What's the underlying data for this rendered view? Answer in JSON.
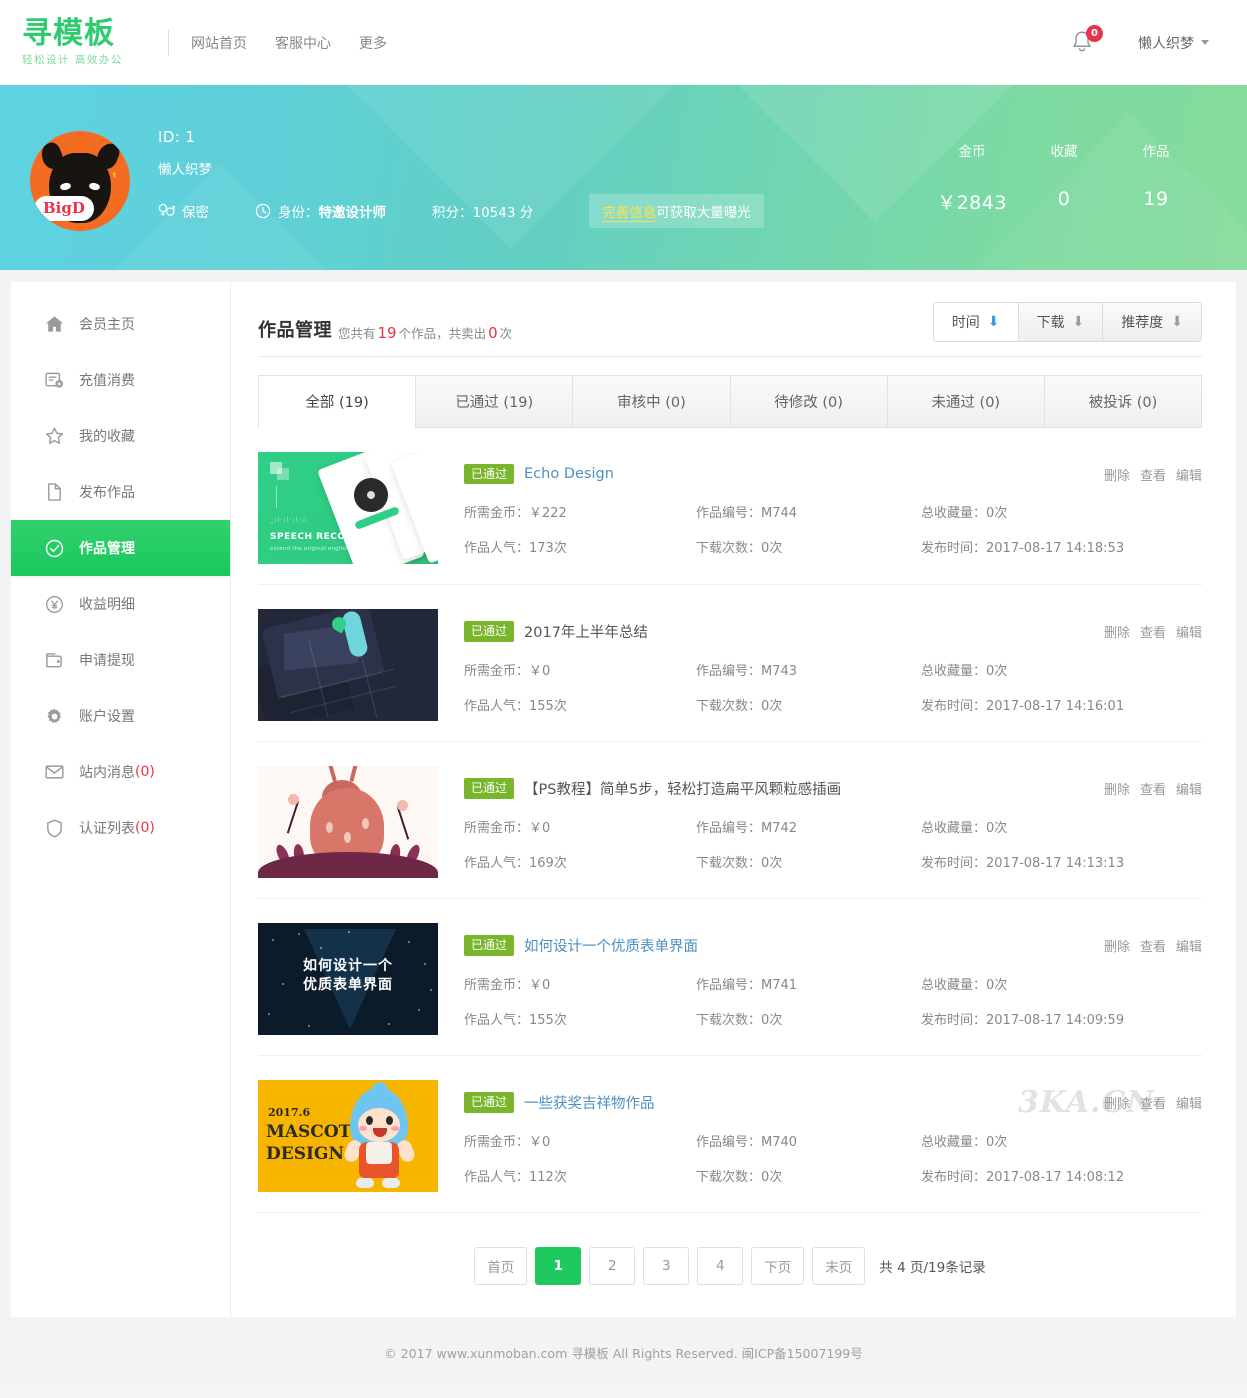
{
  "header": {
    "logo_main": "寻模板",
    "logo_sub": "轻松设计 高效办公",
    "nav": [
      {
        "label": "网站首页"
      },
      {
        "label": "客服中心"
      },
      {
        "label": "更多"
      }
    ],
    "notification_count": "0",
    "username": "懒人织梦"
  },
  "profile": {
    "avatar_text": "BigD",
    "id_label": "ID: 1",
    "nickname": "懒人织梦",
    "gender": "保密",
    "identity_label": "身份：",
    "identity_value": "特邀设计师",
    "points": "积分：10543 分",
    "promo_link": "完善信息",
    "promo_rest": "可获取大量曝光",
    "stats": [
      {
        "label": "金币",
        "value": "￥2843"
      },
      {
        "label": "收藏",
        "value": "0"
      },
      {
        "label": "作品",
        "value": "19"
      }
    ]
  },
  "sidebar": {
    "items": [
      {
        "label": "会员主页",
        "icon": "home-icon",
        "active": false
      },
      {
        "label": "充值消费",
        "icon": "card-icon",
        "active": false
      },
      {
        "label": "我的收藏",
        "icon": "star-icon",
        "active": false
      },
      {
        "label": "发布作品",
        "icon": "file-icon",
        "active": false
      },
      {
        "label": "作品管理",
        "icon": "check-circle-icon",
        "active": true
      },
      {
        "label": "收益明细",
        "icon": "yen-circle-icon",
        "active": false
      },
      {
        "label": "申请提现",
        "icon": "wallet-icon",
        "active": false
      },
      {
        "label": "账户设置",
        "icon": "gear-icon",
        "active": false
      },
      {
        "label": "站内消息",
        "count": "(0)",
        "icon": "envelope-icon",
        "active": false
      },
      {
        "label": "认证列表",
        "count": "(0)",
        "icon": "shield-icon",
        "active": false
      }
    ]
  },
  "main": {
    "title": "作品管理",
    "sub_pre": "您共有",
    "sub_count": "19",
    "sub_mid": "个作品，共卖出",
    "sub_sold": "0",
    "sub_end": "次",
    "sorts": [
      {
        "label": "时间",
        "active": true
      },
      {
        "label": "下载",
        "active": false
      },
      {
        "label": "推荐度",
        "active": false
      }
    ],
    "tabs": [
      {
        "label": "全部 (19)",
        "active": true
      },
      {
        "label": "已通过 (19)",
        "active": false
      },
      {
        "label": "审核中 (0)",
        "active": false
      },
      {
        "label": "待修改 (0)",
        "active": false
      },
      {
        "label": "未通过 (0)",
        "active": false
      },
      {
        "label": "被投诉 (0)",
        "active": false
      }
    ],
    "actions": [
      "删除",
      "查看",
      "编辑"
    ],
    "field_labels": {
      "coin": "所需金币：",
      "code": "作品编号：",
      "favs": "总收藏量：",
      "views": "作品人气：",
      "downloads": "下载次数：",
      "time": "发布时间："
    },
    "watermark": "3KA.CN",
    "works": [
      {
        "status": "已通过",
        "title": "Echo Design",
        "title_link": true,
        "coin": "￥222",
        "code": "M744",
        "favs": "0次",
        "views": "173次",
        "downloads": "0次",
        "time": "2017-08-17 14:18:53",
        "thumb_caption": "SPEECH RECOGNITION",
        "thumb_sub": "extend the original english wordless chat"
      },
      {
        "status": "已通过",
        "title": "2017年上半年总结",
        "title_link": false,
        "coin": "￥0",
        "code": "M743",
        "favs": "0次",
        "views": "155次",
        "downloads": "0次",
        "time": "2017-08-17 14:16:01"
      },
      {
        "status": "已通过",
        "title": "【PS教程】简单5步，轻松打造扁平风颗粒感插画",
        "title_link": false,
        "coin": "￥0",
        "code": "M742",
        "favs": "0次",
        "views": "169次",
        "downloads": "0次",
        "time": "2017-08-17 14:13:13"
      },
      {
        "status": "已通过",
        "title": "如何设计一个优质表单界面",
        "title_link": true,
        "coin": "￥0",
        "code": "M741",
        "favs": "0次",
        "views": "155次",
        "downloads": "0次",
        "time": "2017-08-17 14:09:59",
        "thumb_caption": "如何设计一个\n优质表单界面"
      },
      {
        "status": "已通过",
        "title": "一些获奖吉祥物作品",
        "title_link": true,
        "coin": "￥0",
        "code": "M740",
        "favs": "0次",
        "views": "112次",
        "downloads": "0次",
        "time": "2017-08-17 14:08:12",
        "thumb_year": "2017.6",
        "thumb_line1": "MASCOT",
        "thumb_line2": "DESIGN"
      }
    ],
    "pagination": {
      "first": "首页",
      "pages": [
        "1",
        "2",
        "3",
        "4"
      ],
      "current": "1",
      "next": "下页",
      "last": "末页",
      "info": "共 4 页/19条记录"
    }
  },
  "footer": {
    "text": "© 2017 www.xunmoban.com 寻模板 All Rights Reserved. 闽ICP备15007199号"
  }
}
